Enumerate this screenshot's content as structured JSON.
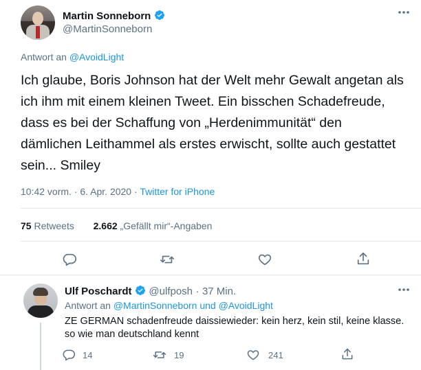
{
  "colors": {
    "link": "#1b95e0",
    "secondary": "#5b7083",
    "verified": "#1da1f2",
    "divider": "#e1e8ed"
  },
  "main_tweet": {
    "author": {
      "name": "Martin Sonneborn",
      "handle": "@MartinSonneborn",
      "verified_icon": "verified-badge-icon"
    },
    "more_icon": "more-dots-icon",
    "reply_prefix": "Antwort an",
    "reply_to": "@AvoidLight",
    "text": "Ich glaube, Boris Johnson hat der Welt mehr Gewalt angetan als ich ihm mit einem kleinen Tweet. Ein bisschen Schadefreude, dass es bei der Schaffung von „Herdenimmunität“ den dämlichen Leithammel als erstes erwischt, sollte auch gestattet sein... Smiley",
    "timestamp": "10:42 vorm. · 6. Apr. 2020",
    "separator": "·",
    "source": "Twitter for iPhone",
    "retweets_count": "75",
    "retweets_label": "Retweets",
    "likes_count": "2.662",
    "likes_label": "„Gefällt mir“-Angaben",
    "actions": [
      "reply-icon",
      "retweet-icon",
      "like-icon",
      "share-icon"
    ]
  },
  "reply_tweet": {
    "author": {
      "name": "Ulf Poschardt",
      "handle": "@ulfposh",
      "verified_icon": "verified-badge-icon"
    },
    "separator": "·",
    "time": "37 Min.",
    "more_icon": "more-dots-icon",
    "reply_prefix": "Antwort an",
    "reply_to": "@MartinSonneborn und @AvoidLight",
    "text": "ZE GERMAN schadenfreude daissiewieder: kein herz, kein stil, keine klasse. so wie man deutschland kennt",
    "reply_count": "14",
    "retweet_count": "19",
    "like_count": "241"
  }
}
